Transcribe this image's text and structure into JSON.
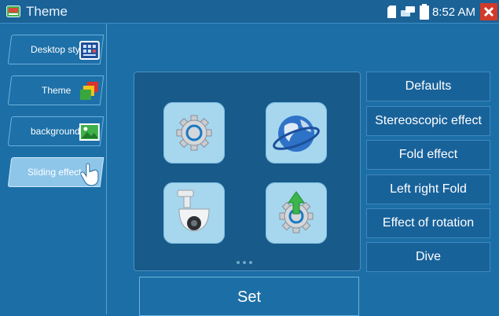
{
  "titlebar": {
    "title": "Theme",
    "app_icon": "theme-app-icon",
    "clock": "8:52 AM",
    "status_icons": [
      "sd-card-icon",
      "network-icon",
      "battery-icon"
    ],
    "close_icon": "close-icon",
    "close_color": "#d23a2a"
  },
  "sidebar": {
    "items": [
      {
        "label": "Desktop style",
        "icon": "desktop-style-icon"
      },
      {
        "label": "Theme",
        "icon": "theme-icon"
      },
      {
        "label": "background",
        "icon": "background-image-icon"
      },
      {
        "label": "Sliding effect",
        "icon": "hand-pointer-icon",
        "active": true
      }
    ]
  },
  "preview": {
    "apps": [
      "settings-gear-icon",
      "globe-icon",
      "ptz-camera-icon",
      "update-arrow-gear-icon"
    ],
    "page_indicator_count": 3
  },
  "set_button": {
    "label": "Set"
  },
  "options": [
    {
      "label": "Defaults"
    },
    {
      "label": "Stereoscopic effect"
    },
    {
      "label": "Fold effect"
    },
    {
      "label": "Left right Fold"
    },
    {
      "label": "Effect of rotation"
    },
    {
      "label": "Dive"
    }
  ],
  "colors": {
    "background": "#1c6fa6",
    "titlebar": "#1b6297",
    "active_tab": "#8ec6ea",
    "tile": "#a6d7ee"
  }
}
